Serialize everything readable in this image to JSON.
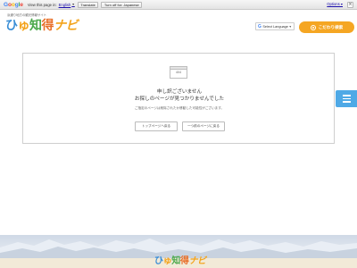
{
  "translate_bar": {
    "logo_letters": [
      "G",
      "o",
      "o",
      "g",
      "l",
      "e"
    ],
    "logo_colors": [
      "#4285f4",
      "#ea4335",
      "#fbbc05",
      "#4285f4",
      "#34a853",
      "#ea4335"
    ],
    "view_text": "View this page in:",
    "language": "English",
    "translate_label": "Translate",
    "turn_off_label": "Turn off for: Japanese",
    "options_label": "Options ▾",
    "close_label": "×"
  },
  "header": {
    "tagline": "浜通り地方の観光情報サイト",
    "logo_parts": [
      "ひ",
      "ゅ",
      "知",
      "得",
      "ナビ"
    ],
    "language_select": {
      "icon": "G",
      "label": "Select Language",
      "caret": "▼"
    },
    "search_button_label": "こだわり検索"
  },
  "error": {
    "icon_text": "404",
    "title_line1": "申し訳ございません",
    "title_line2": "お探しのページが見つかりませんでした",
    "description": "ご指定のページは削除されたか移動した可能性がございます。",
    "top_button_label": "トップページへ戻る",
    "back_button_label": "一つ前のページに戻る"
  },
  "side_tab": {
    "icon": "menu-icon"
  },
  "footer": {
    "logo_parts": [
      "ひ",
      "ゅ",
      "知",
      "得",
      "ナビ"
    ]
  },
  "colors": {
    "accent_orange": "#f5a623",
    "side_tab_blue": "#4fa9e6",
    "logo_blue": "#3a8ed6",
    "logo_orange": "#f3a31b",
    "logo_green": "#4aa84a"
  }
}
